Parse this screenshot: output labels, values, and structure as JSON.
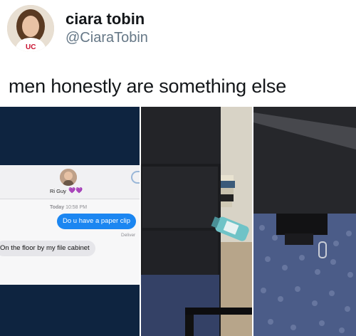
{
  "tweet": {
    "display_name": "ciara tobin",
    "handle": "@CiaraTobin",
    "text": "men honestly are something else"
  },
  "chat": {
    "contact_name": "Ri Guy",
    "contact_emoji": "💜💜",
    "timestamp_day": "Today",
    "timestamp_time": "10:58 PM",
    "outgoing_message": "Do u have a paper clip",
    "delivery_status": "Deliver",
    "incoming_message": "On the floor by my file cabinet"
  },
  "colors": {
    "chat_bubble_outgoing": "#1b86f1",
    "chat_bubble_incoming": "#e6e6ea",
    "phone_background": "#0e2440",
    "handle_gray": "#657786"
  },
  "icons": {
    "contact_avatar": "person-avatar-icon",
    "back_chevron": "chevron-left-icon"
  }
}
